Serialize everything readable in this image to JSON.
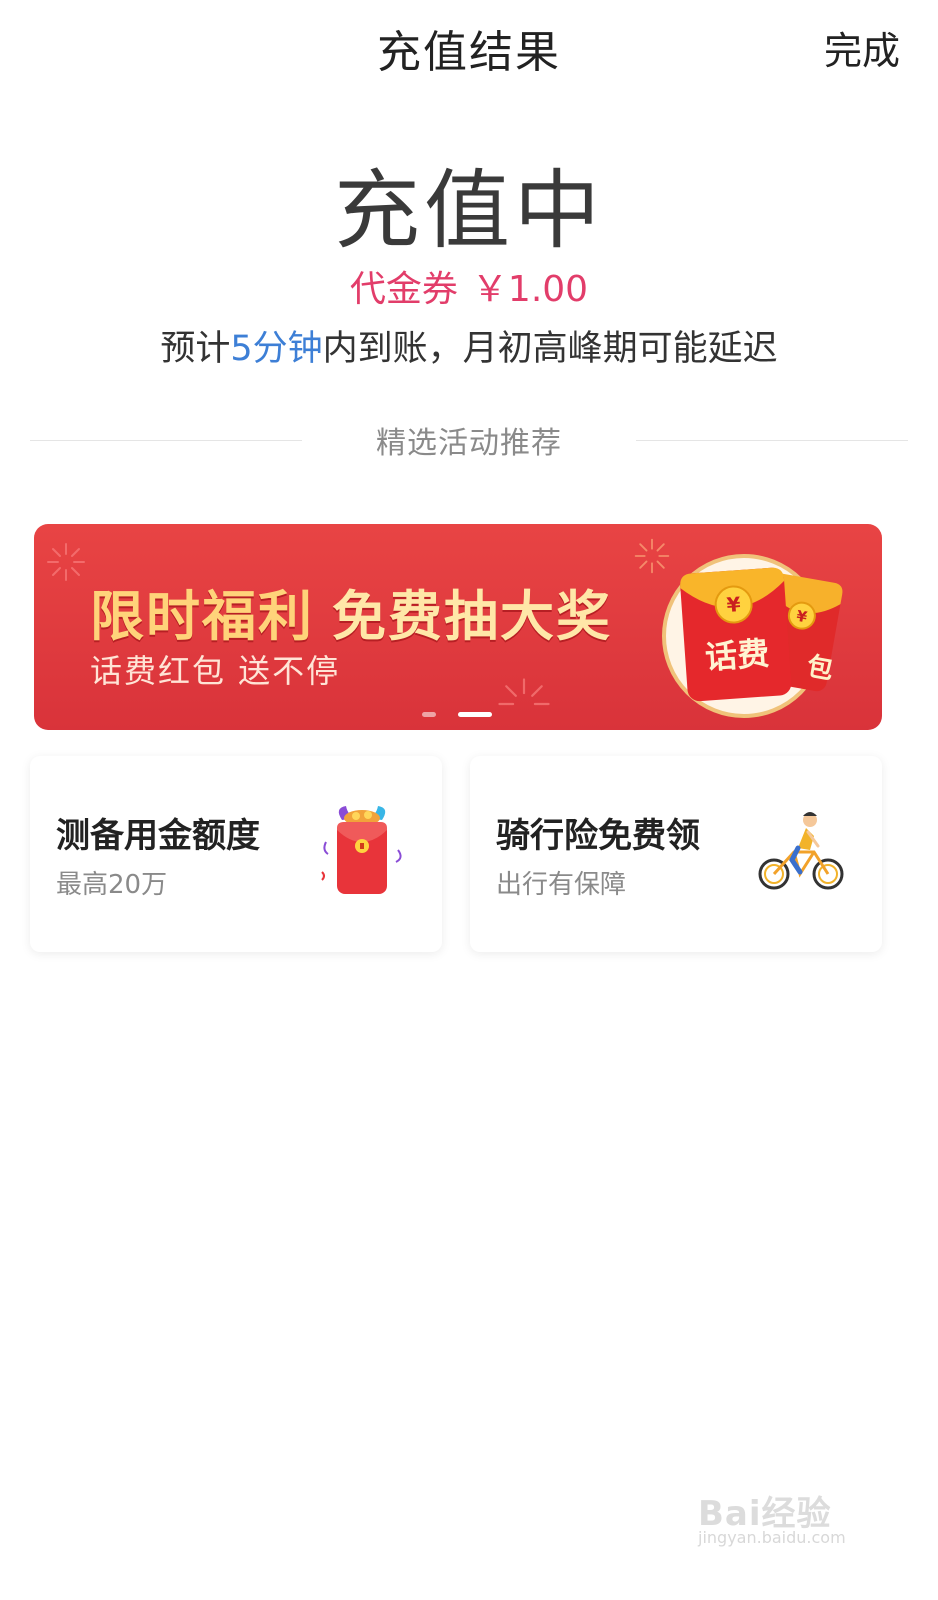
{
  "header": {
    "title": "充值结果",
    "done_label": "完成"
  },
  "status": {
    "main": "充值中",
    "voucher_label": "代金券",
    "voucher_amount": "￥1.00",
    "eta_prefix": "预计",
    "eta_highlight": "5分钟",
    "eta_suffix": "内到账，月初高峰期可能延迟"
  },
  "section": {
    "title": "精选活动推荐"
  },
  "banner": {
    "title_part1": "限时福利",
    "title_part2": "免费抽大奖",
    "subtitle": "话费红包 送不停",
    "envelope_text": "话费",
    "envelope_text_back": "包",
    "currency_symbol": "¥",
    "active_slide": 2,
    "slide_count": 2
  },
  "cards": [
    {
      "title": "测备用金额度",
      "subtitle": "最高20万",
      "icon": "red-envelope-icon"
    },
    {
      "title": "骑行险免费领",
      "subtitle": "出行有保障",
      "icon": "cyclist-icon"
    }
  ],
  "watermark": {
    "brand": "Bai经验",
    "url": "jingyan.baidu.com"
  },
  "colors": {
    "accent_pink": "#e23d6a",
    "highlight_blue": "#3d7fd6",
    "banner_red": "#e23b3f",
    "banner_gold": "#ffd37a"
  }
}
